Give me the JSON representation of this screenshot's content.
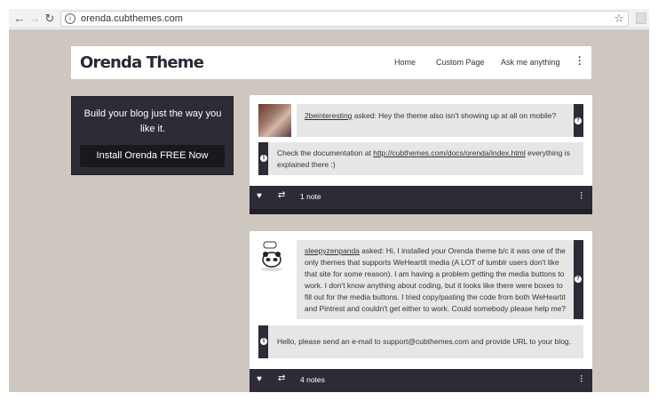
{
  "browser": {
    "url": "orenda.cubthemes.com"
  },
  "header": {
    "logo": "Orenda Theme",
    "menu": [
      "Home",
      "Custom Page",
      "Ask me anything"
    ]
  },
  "promo": {
    "text": "Build your blog just the way you like it.",
    "button": "Install Orenda FREE Now"
  },
  "posts": [
    {
      "asker": "2beinteresting",
      "question": " asked: Hey the theme also isn't showing up at all on mobile?",
      "answer_prefix": "Check the documentation at ",
      "answer_link": "http://cubthemes.com/docs/orenda/index.html",
      "answer_suffix": " everything is explained there :)",
      "notes": "1 note"
    },
    {
      "asker": "sleepyzenpanda",
      "question": " asked: Hi, I installed your Orenda theme b/c it was one of the only themes that supports WeHeartIt media (A LOT of tumblr users don't like that site for some reason). I am having a problem getting the media buttons to work. I don't know anything about coding, but it looks like there were boxes to fill out for the media buttons. I tried copy/pasting the code from both WeHeartit and Pintrest and couldn't get either to work. Could somebody please help me?",
      "answer": "Hello, please send an e-mail to support@cubthemes.com and provide URL to your blog.",
      "notes": "4 notes"
    }
  ],
  "colors": {
    "dark": "#2e2a36",
    "background": "#cdc7bf",
    "bubble": "#e6e6e6"
  }
}
